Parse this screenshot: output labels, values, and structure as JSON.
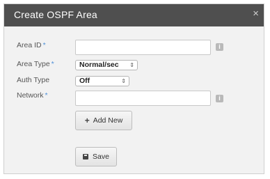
{
  "dialog": {
    "title": "Create OSPF Area",
    "close_glyph": "×"
  },
  "form": {
    "area_id": {
      "label": "Area ID",
      "required": "*",
      "value": "",
      "placeholder": ""
    },
    "area_type": {
      "label": "Area Type",
      "required": "*",
      "selected": "Normal/sec"
    },
    "auth_type": {
      "label": "Auth Type",
      "selected": "Off"
    },
    "network": {
      "label": "Network",
      "required": "*",
      "value": "",
      "placeholder": ""
    },
    "info_glyph": "i",
    "select_arrow": "⇕"
  },
  "buttons": {
    "add_new": {
      "icon": "+",
      "label": "Add New"
    },
    "save": {
      "label": "Save"
    }
  },
  "colors": {
    "header_bg": "#4f4f4f",
    "panel_bg": "#f2f2f2",
    "required_marker": "#4e90d8"
  }
}
